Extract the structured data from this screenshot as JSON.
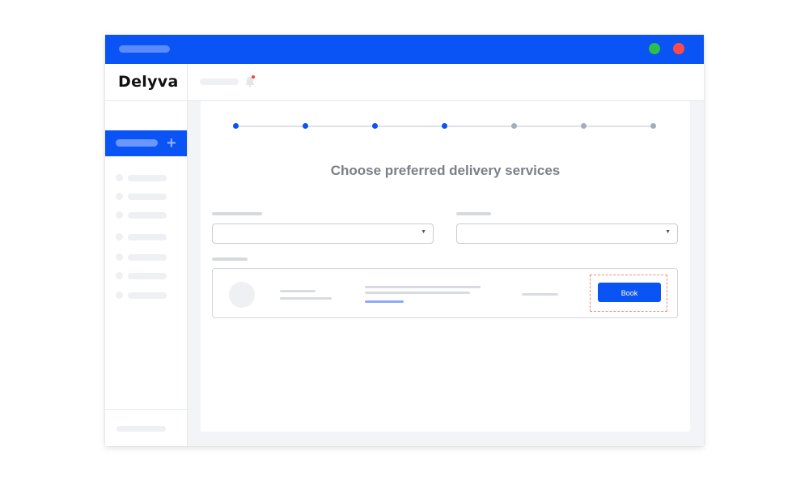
{
  "app": {
    "logo_text": "Delyva"
  },
  "colors": {
    "brand": "#0a53f5",
    "window_green": "#2dbe4c",
    "window_red": "#ff4a4a",
    "notification_badge": "#ff3b3b"
  },
  "stepper": {
    "total_steps": 7,
    "completed_steps": 4
  },
  "main": {
    "heading": "Choose preferred delivery services",
    "selects": [
      {
        "value": "",
        "icon": "caret-down-icon"
      },
      {
        "value": "",
        "icon": "caret-down-icon"
      }
    ],
    "service_row": {
      "book_label": "Book"
    }
  },
  "icons": {
    "sidebar_new": "plus-icon",
    "topbar": "bell-icon"
  }
}
